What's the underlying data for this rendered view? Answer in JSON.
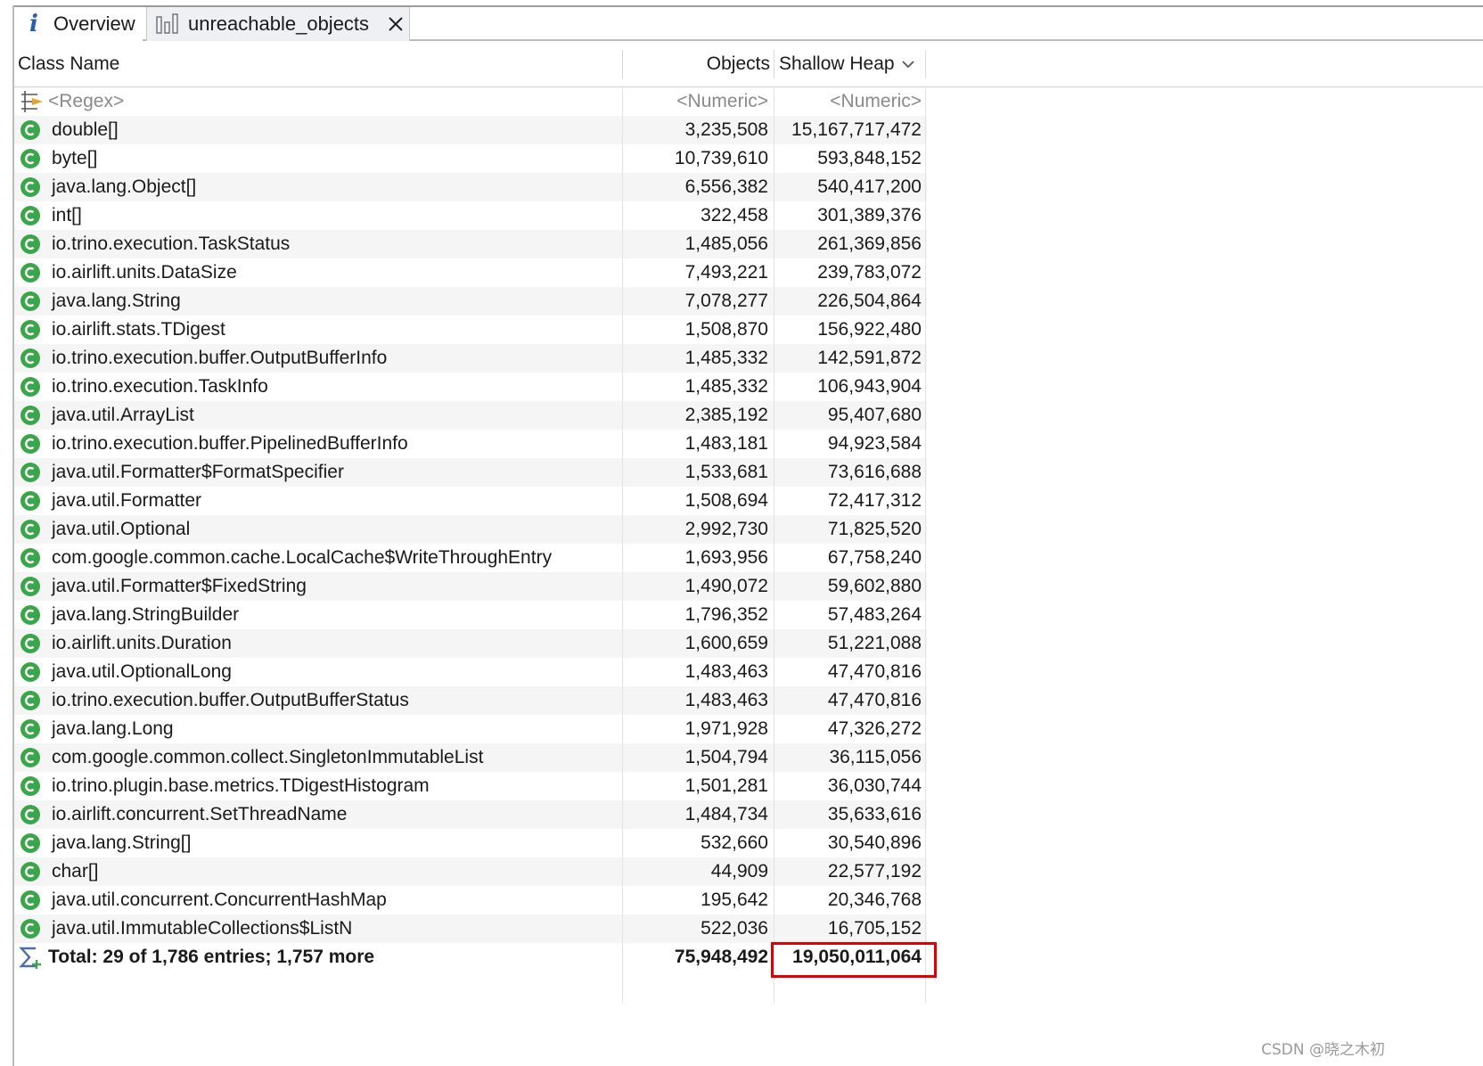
{
  "tabs": [
    {
      "label": "Overview",
      "icon": "info-icon"
    },
    {
      "label": "unreachable_objects",
      "icon": "histogram-icon",
      "closable": true
    }
  ],
  "columns": {
    "class_name": "Class Name",
    "objects": "Objects",
    "shallow_heap": "Shallow Heap"
  },
  "filter_row": {
    "class_name": "<Regex>",
    "objects": "<Numeric>",
    "shallow_heap": "<Numeric>"
  },
  "rows": [
    {
      "name": "double[]",
      "objects": "3,235,508",
      "shallow": "15,167,717,472"
    },
    {
      "name": "byte[]",
      "objects": "10,739,610",
      "shallow": "593,848,152"
    },
    {
      "name": "java.lang.Object[]",
      "objects": "6,556,382",
      "shallow": "540,417,200"
    },
    {
      "name": "int[]",
      "objects": "322,458",
      "shallow": "301,389,376"
    },
    {
      "name": "io.trino.execution.TaskStatus",
      "objects": "1,485,056",
      "shallow": "261,369,856"
    },
    {
      "name": "io.airlift.units.DataSize",
      "objects": "7,493,221",
      "shallow": "239,783,072"
    },
    {
      "name": "java.lang.String",
      "objects": "7,078,277",
      "shallow": "226,504,864"
    },
    {
      "name": "io.airlift.stats.TDigest",
      "objects": "1,508,870",
      "shallow": "156,922,480"
    },
    {
      "name": "io.trino.execution.buffer.OutputBufferInfo",
      "objects": "1,485,332",
      "shallow": "142,591,872"
    },
    {
      "name": "io.trino.execution.TaskInfo",
      "objects": "1,485,332",
      "shallow": "106,943,904"
    },
    {
      "name": "java.util.ArrayList",
      "objects": "2,385,192",
      "shallow": "95,407,680"
    },
    {
      "name": "io.trino.execution.buffer.PipelinedBufferInfo",
      "objects": "1,483,181",
      "shallow": "94,923,584"
    },
    {
      "name": "java.util.Formatter$FormatSpecifier",
      "objects": "1,533,681",
      "shallow": "73,616,688"
    },
    {
      "name": "java.util.Formatter",
      "objects": "1,508,694",
      "shallow": "72,417,312"
    },
    {
      "name": "java.util.Optional",
      "objects": "2,992,730",
      "shallow": "71,825,520"
    },
    {
      "name": "com.google.common.cache.LocalCache$WriteThroughEntry",
      "objects": "1,693,956",
      "shallow": "67,758,240"
    },
    {
      "name": "java.util.Formatter$FixedString",
      "objects": "1,490,072",
      "shallow": "59,602,880"
    },
    {
      "name": "java.lang.StringBuilder",
      "objects": "1,796,352",
      "shallow": "57,483,264"
    },
    {
      "name": "io.airlift.units.Duration",
      "objects": "1,600,659",
      "shallow": "51,221,088"
    },
    {
      "name": "java.util.OptionalLong",
      "objects": "1,483,463",
      "shallow": "47,470,816"
    },
    {
      "name": "io.trino.execution.buffer.OutputBufferStatus",
      "objects": "1,483,463",
      "shallow": "47,470,816"
    },
    {
      "name": "java.lang.Long",
      "objects": "1,971,928",
      "shallow": "47,326,272"
    },
    {
      "name": "com.google.common.collect.SingletonImmutableList",
      "objects": "1,504,794",
      "shallow": "36,115,056"
    },
    {
      "name": "io.trino.plugin.base.metrics.TDigestHistogram",
      "objects": "1,501,281",
      "shallow": "36,030,744"
    },
    {
      "name": "io.airlift.concurrent.SetThreadName",
      "objects": "1,484,734",
      "shallow": "35,633,616"
    },
    {
      "name": "java.lang.String[]",
      "objects": "532,660",
      "shallow": "30,540,896"
    },
    {
      "name": "char[]",
      "objects": "44,909",
      "shallow": "22,577,192"
    },
    {
      "name": "java.util.concurrent.ConcurrentHashMap",
      "objects": "195,642",
      "shallow": "20,346,768"
    },
    {
      "name": "java.util.ImmutableCollections$ListN",
      "objects": "522,036",
      "shallow": "16,705,152"
    }
  ],
  "total": {
    "label": "Total: 29 of 1,786 entries; 1,757 more",
    "objects": "75,948,492",
    "shallow": "19,050,011,064"
  },
  "watermark": "CSDN @晓之木初",
  "colors": {
    "class_icon": "#3aa54a",
    "highlight": "#e00000",
    "accent": "#2a5fb0"
  }
}
